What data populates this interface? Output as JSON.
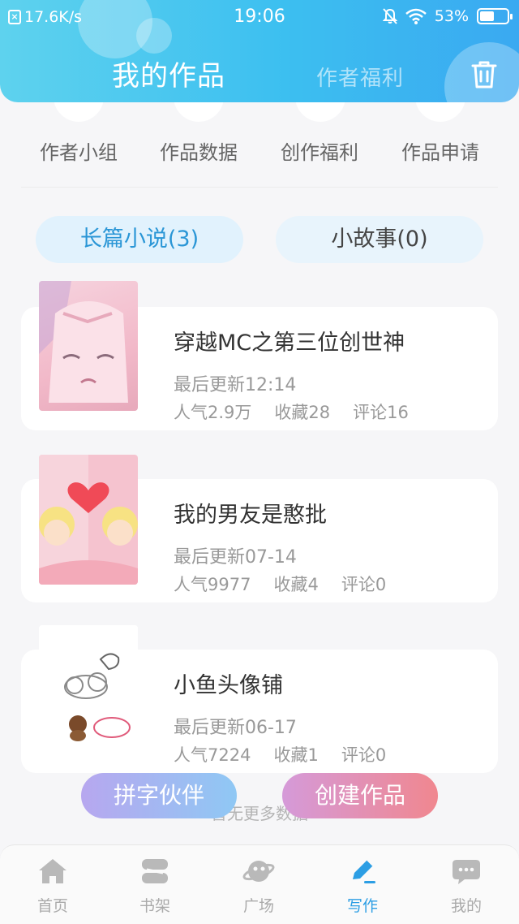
{
  "status_bar": {
    "net_speed": "17.6K/s",
    "time": "19:06",
    "battery": "53%",
    "battery_level": 0.53
  },
  "header": {
    "tab_active": "我的作品",
    "tab_inactive": "作者福利",
    "trash_icon": "trash-icon"
  },
  "quick_actions": [
    {
      "label": "作者小组"
    },
    {
      "label": "作品数据"
    },
    {
      "label": "创作福利"
    },
    {
      "label": "作品申请"
    }
  ],
  "category_tabs": {
    "novel": "长篇小说(3)",
    "story": "小故事(0)"
  },
  "works": [
    {
      "title": "穿越MC之第三位创世神",
      "updated": "最后更新12:14",
      "popularity": "人气2.9万",
      "favorites": "收藏28",
      "comments": "评论16"
    },
    {
      "title": "我的男友是憨批",
      "updated": "最后更新07-14",
      "popularity": "人气9977",
      "favorites": "收藏4",
      "comments": "评论0"
    },
    {
      "title": "小鱼头像铺",
      "updated": "最后更新06-17",
      "popularity": "人气7224",
      "favorites": "收藏1",
      "comments": "评论0"
    }
  ],
  "no_more_text": "暂无更多数据",
  "buttons": {
    "partner": "拼字伙伴",
    "create": "创建作品"
  },
  "bottom_nav": [
    {
      "label": "首页",
      "icon": "home-icon"
    },
    {
      "label": "书架",
      "icon": "bookshelf-icon"
    },
    {
      "label": "广场",
      "icon": "planet-icon"
    },
    {
      "label": "写作",
      "icon": "pen-icon"
    },
    {
      "label": "我的",
      "icon": "chat-icon"
    }
  ],
  "colors": {
    "accent": "#2c9ee4",
    "header_start": "#5ed2ee",
    "header_end": "#3aa9f1"
  }
}
